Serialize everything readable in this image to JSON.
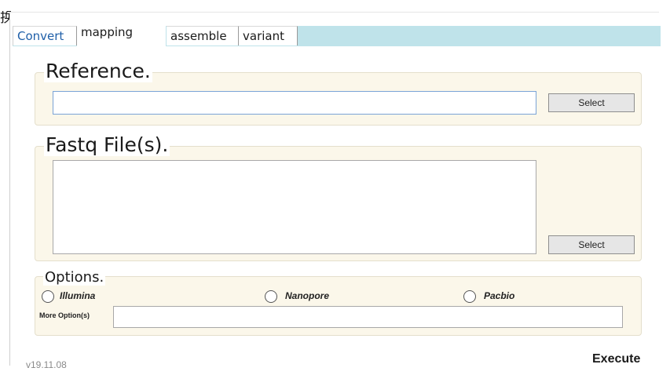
{
  "corner_text": "换",
  "tabs": [
    {
      "label": "Convert"
    },
    {
      "label": "mapping"
    },
    {
      "label": "assemble"
    },
    {
      "label": "variant"
    }
  ],
  "reference": {
    "legend": "Reference.",
    "value": "",
    "select_label": "Select"
  },
  "fastq": {
    "legend": "Fastq File(s).",
    "value": "",
    "select_label": "Select"
  },
  "options": {
    "legend": "Options.",
    "radios": [
      {
        "label": "Illumina",
        "checked": false
      },
      {
        "label": "Nanopore",
        "checked": false
      },
      {
        "label": "Pacbio",
        "checked": false
      }
    ],
    "more_label": "More Option(s)",
    "more_value": ""
  },
  "footer": {
    "version": "v19.11.08",
    "execute_label": "Execute"
  }
}
